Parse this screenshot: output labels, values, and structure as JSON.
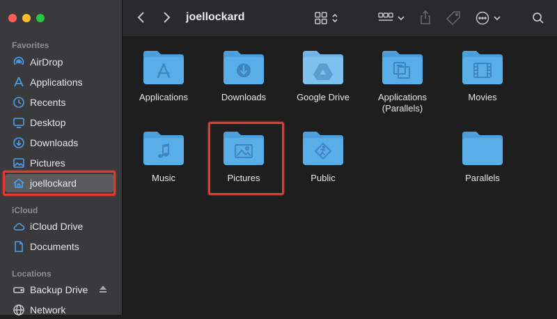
{
  "window": {
    "title": "joellockard"
  },
  "colors": {
    "close": "#ff5f57",
    "minimize": "#febc2e",
    "zoom": "#28c840",
    "folder": "#5aaee8",
    "accent": "#e23b2e"
  },
  "sidebar": {
    "favorites_label": "Favorites",
    "favorites": [
      {
        "label": "AirDrop",
        "icon": "airdrop-icon"
      },
      {
        "label": "Applications",
        "icon": "applications-icon"
      },
      {
        "label": "Recents",
        "icon": "recents-icon"
      },
      {
        "label": "Desktop",
        "icon": "desktop-icon"
      },
      {
        "label": "Downloads",
        "icon": "downloads-icon"
      },
      {
        "label": "Pictures",
        "icon": "pictures-icon"
      },
      {
        "label": "joellockard",
        "icon": "home-icon",
        "selected": true
      }
    ],
    "icloud_label": "iCloud",
    "icloud": [
      {
        "label": "iCloud Drive",
        "icon": "cloud-icon"
      },
      {
        "label": "Documents",
        "icon": "document-icon"
      }
    ],
    "locations_label": "Locations",
    "locations": [
      {
        "label": "Backup Drive",
        "icon": "drive-icon",
        "eject": true
      },
      {
        "label": "Network",
        "icon": "network-icon"
      }
    ]
  },
  "files": [
    {
      "label": "Applications",
      "glyph": "app-store"
    },
    {
      "label": "Downloads",
      "glyph": "download"
    },
    {
      "label": "Google Drive",
      "glyph": "gdrive"
    },
    {
      "label": "Applications (Parallels)",
      "glyph": "parallels-app"
    },
    {
      "label": "Movies",
      "glyph": "film"
    },
    {
      "label": "Music",
      "glyph": "music"
    },
    {
      "label": "Pictures",
      "glyph": "photo"
    },
    {
      "label": "Public",
      "glyph": "public"
    },
    {
      "label": "Parallels",
      "glyph": "none"
    }
  ]
}
